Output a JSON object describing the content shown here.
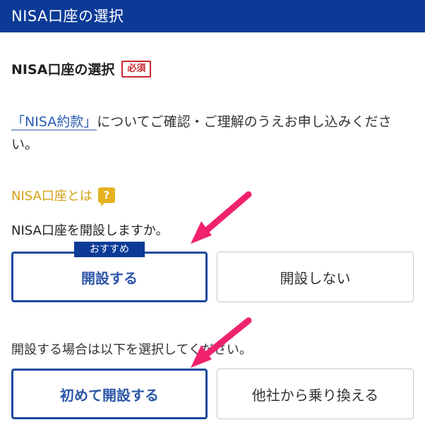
{
  "header": {
    "title": "NISA口座の選択"
  },
  "section": {
    "title": "NISA口座の選択",
    "required_badge": "必須"
  },
  "description": {
    "link_text": "「NISA約款」",
    "text": "についてご確認・ご理解のうえお申し込みください。"
  },
  "nisa_about": {
    "label": "NISA口座とは",
    "icon": "help-icon"
  },
  "question_open": {
    "text": "NISA口座を開設しますか。",
    "recommend_tag": "おすすめ",
    "options": [
      {
        "label": "開設する",
        "selected": true
      },
      {
        "label": "開設しない",
        "selected": false
      }
    ]
  },
  "question_type": {
    "text": "開設する場合は以下を選択してください。",
    "options": [
      {
        "label": "初めて開設する",
        "selected": true
      },
      {
        "label": "他社から乗り換える",
        "selected": false
      }
    ]
  },
  "colors": {
    "header_bg": "#0b3a97",
    "selected_border": "#1d4a9e",
    "required": "#c9262c",
    "help_icon": "#e6b21e",
    "arrow": "#f0226e"
  }
}
